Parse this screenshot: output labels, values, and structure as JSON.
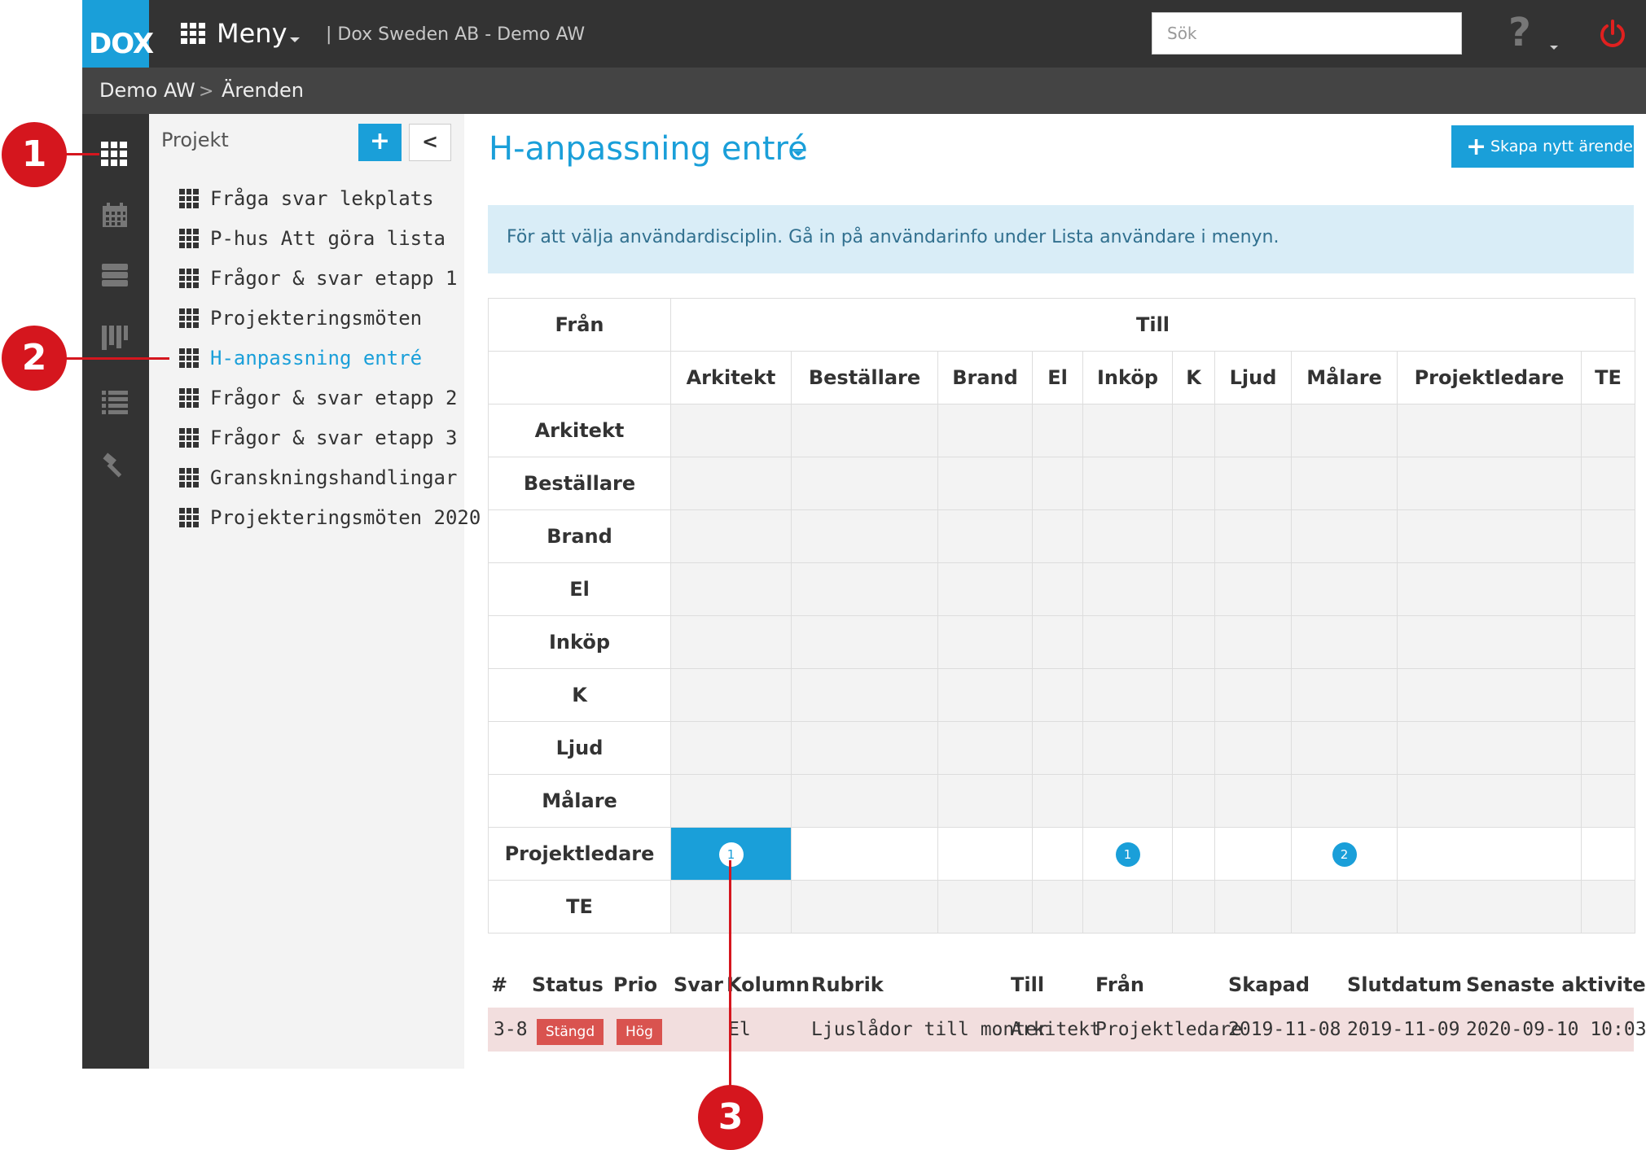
{
  "topbar": {
    "logo_text": "DOX",
    "menu_label": "Meny",
    "company": "| Dox Sweden AB - Demo AW",
    "search_placeholder": "Sök",
    "help_icon": "?",
    "accent": "#1a9fd9"
  },
  "breadcrumb": {
    "items": [
      "Demo AW",
      "Ärenden"
    ],
    "separator": ">"
  },
  "rail": {
    "icons": [
      "grid-icon",
      "calendar-icon",
      "server-icon",
      "board-icon",
      "list-icon",
      "gavel-icon"
    ]
  },
  "projects": {
    "title": "Projekt",
    "add_label": "+",
    "collapse_label": "<",
    "items": [
      "Fråga svar lekplats",
      "P-hus Att göra lista",
      "Frågor & svar etapp 1",
      "Projekteringsmöten",
      "H-anpassning entré",
      "Frågor & svar etapp 2",
      "Frågor & svar etapp 3",
      "Granskningshandlingar",
      "Projekteringsmöten 2020"
    ],
    "active": "H-anpassning entré"
  },
  "main": {
    "title": "H-anpassning entré",
    "create_label": "Skapa nytt ärende",
    "info": "För att välja användardisciplin. Gå in på användarinfo under Lista användare i menyn."
  },
  "matrix": {
    "from_label": "Från",
    "to_label": "Till",
    "columns": [
      "Arkitekt",
      "Beställare",
      "Brand",
      "El",
      "Inköp",
      "K",
      "Ljud",
      "Målare",
      "Projektledare",
      "TE"
    ],
    "rows": [
      "Arkitekt",
      "Beställare",
      "Brand",
      "El",
      "Inköp",
      "K",
      "Ljud",
      "Målare",
      "Projektledare",
      "TE"
    ],
    "counts": {
      "Projektledare": {
        "Arkitekt": "1",
        "Inköp": "1",
        "Målare": "2"
      }
    }
  },
  "issues": {
    "headers": [
      "#",
      "Status",
      "Prio",
      "Svar",
      "Kolumn",
      "Rubrik",
      "Till",
      "Från",
      "Skapad",
      "Slutdatum",
      "Senaste aktivitet"
    ],
    "rows": [
      {
        "id": "3-8",
        "status": "Stängd",
        "prio": "Hög",
        "svar": "",
        "kolumn": "El",
        "rubrik": "Ljuslådor till monter",
        "till": "Arkitekt",
        "fran": "Projektledare",
        "skapad": "2019-11-08",
        "slutdatum": "2019-11-09",
        "senaste": "2020-09-10 10:03"
      }
    ],
    "status_color": "#d9534f"
  },
  "callouts": [
    "1",
    "2",
    "3"
  ]
}
